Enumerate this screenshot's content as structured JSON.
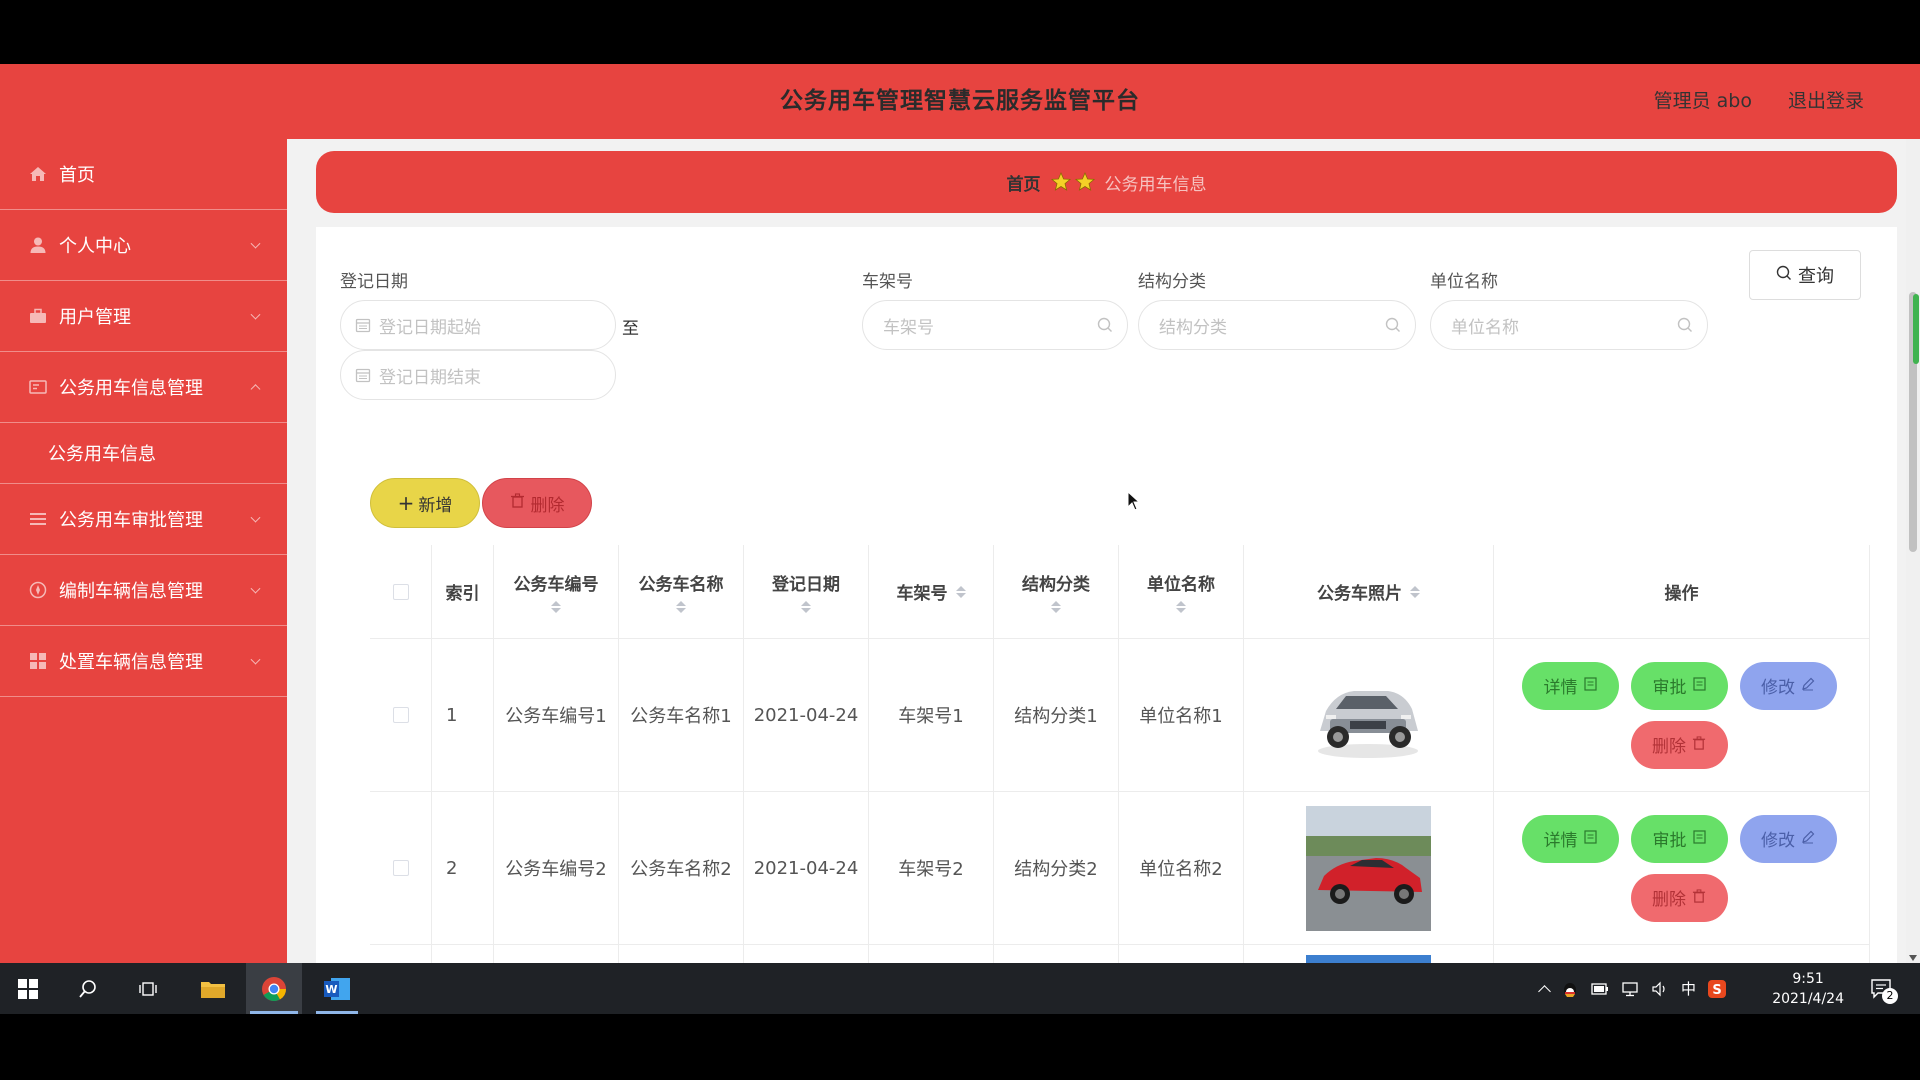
{
  "header": {
    "title": "公务用车管理智慧云服务监管平台",
    "user": "管理员 abo",
    "logout": "退出登录"
  },
  "sidebar": {
    "items": [
      {
        "label": "首页",
        "icon": "home-icon"
      },
      {
        "label": "个人中心",
        "icon": "user-icon"
      },
      {
        "label": "用户管理",
        "icon": "briefcase-icon"
      },
      {
        "label": "公务用车信息管理",
        "icon": "card-icon"
      },
      {
        "label": "公务用车信息",
        "icon": ""
      },
      {
        "label": "公务用车审批管理",
        "icon": "list-icon"
      },
      {
        "label": "编制车辆信息管理",
        "icon": "compass-icon"
      },
      {
        "label": "处置车辆信息管理",
        "icon": "grid-icon"
      }
    ]
  },
  "breadcrumb": {
    "home": "首页",
    "current": "公务用车信息"
  },
  "search": {
    "date_label": "登记日期",
    "date_start_placeholder": "登记日期起始",
    "date_end_placeholder": "登记日期结束",
    "to_label": "至",
    "frame_label": "车架号",
    "frame_placeholder": "车架号",
    "structure_label": "结构分类",
    "structure_placeholder": "结构分类",
    "unit_label": "单位名称",
    "unit_placeholder": "单位名称",
    "query_button": "查询"
  },
  "actions": {
    "add": "新增",
    "delete": "删除"
  },
  "table": {
    "columns": [
      "索引",
      "公务车编号",
      "公务车名称",
      "登记日期",
      "车架号",
      "结构分类",
      "单位名称",
      "公务车照片",
      "操作"
    ],
    "rows": [
      {
        "index": "1",
        "code": "公务车编号1",
        "name": "公务车名称1",
        "date": "2021-04-24",
        "frame": "车架号1",
        "structure": "结构分类1",
        "unit": "单位名称1"
      },
      {
        "index": "2",
        "code": "公务车编号2",
        "name": "公务车名称2",
        "date": "2021-04-24",
        "frame": "车架号2",
        "structure": "结构分类2",
        "unit": "单位名称2"
      }
    ],
    "op_labels": {
      "detail": "详情",
      "approve": "审批",
      "edit": "修改",
      "delete": "删除"
    }
  },
  "taskbar": {
    "time": "9:51",
    "date": "2021/4/24",
    "ime": "中",
    "notifications": "2"
  },
  "colors": {
    "brand_red": "#e74440",
    "add_yellow": "#e8d548",
    "detail_green": "#67e068",
    "edit_blue": "#8fa4ee",
    "delete_red": "#f06a6e"
  }
}
